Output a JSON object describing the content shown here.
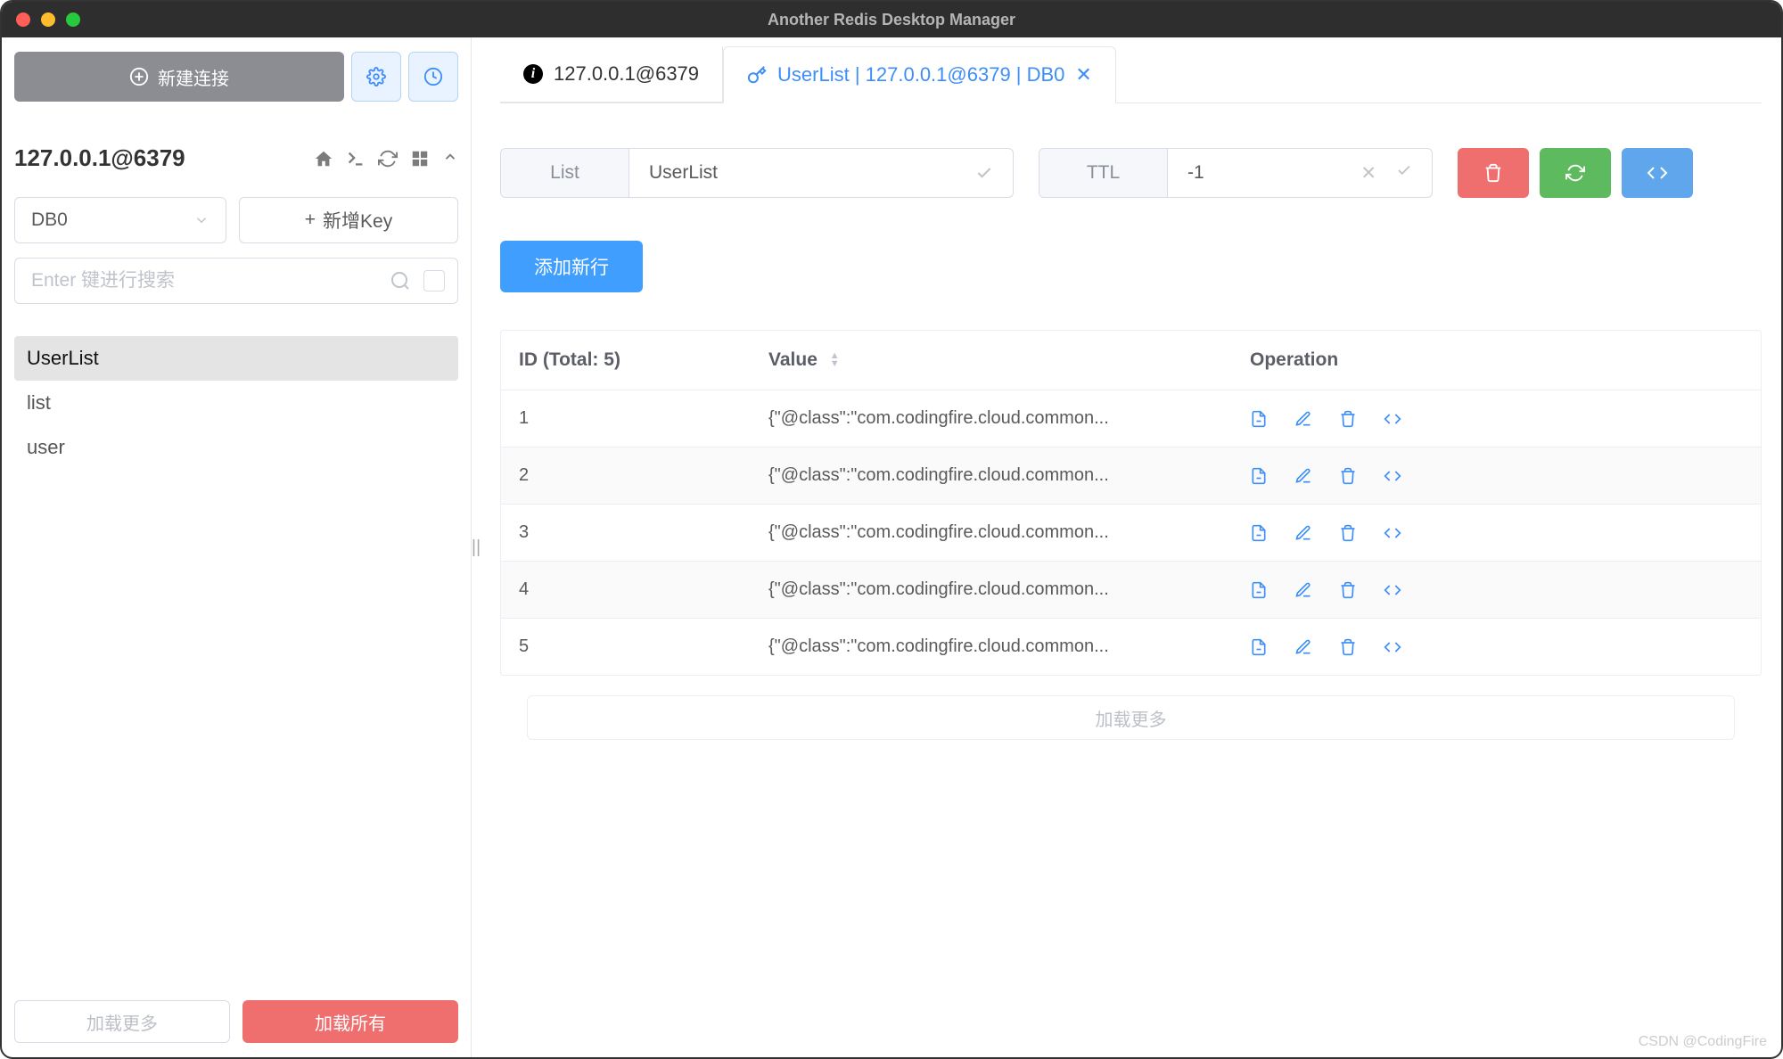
{
  "app": {
    "title": "Another Redis Desktop Manager"
  },
  "sidebar": {
    "newConn": "新建连接",
    "connection": "127.0.0.1@6379",
    "dbSelected": "DB0",
    "newKey": "新增Key",
    "searchPlaceholder": "Enter 键进行搜索",
    "keys": [
      {
        "name": "UserList",
        "active": true
      },
      {
        "name": "list",
        "active": false
      },
      {
        "name": "user",
        "active": false
      }
    ],
    "loadMore": "加载更多",
    "loadAll": "加载所有"
  },
  "tabs": [
    {
      "type": "info",
      "label": "127.0.0.1@6379",
      "active": false
    },
    {
      "type": "key",
      "label": "UserList | 127.0.0.1@6379 | DB0",
      "active": true
    }
  ],
  "toolbar": {
    "keyTypeLabel": "List",
    "keyName": "UserList",
    "ttlLabel": "TTL",
    "ttlValue": "-1"
  },
  "addRow": "添加新行",
  "table": {
    "idHeader": "ID (Total: 5)",
    "valueHeader": "Value",
    "opHeader": "Operation",
    "rows": [
      {
        "id": "1",
        "value": "{\"@class\":\"com.codingfire.cloud.common..."
      },
      {
        "id": "2",
        "value": "{\"@class\":\"com.codingfire.cloud.common..."
      },
      {
        "id": "3",
        "value": "{\"@class\":\"com.codingfire.cloud.common..."
      },
      {
        "id": "4",
        "value": "{\"@class\":\"com.codingfire.cloud.common..."
      },
      {
        "id": "5",
        "value": "{\"@class\":\"com.codingfire.cloud.common..."
      }
    ],
    "loadMore": "加载更多"
  },
  "watermark": "CSDN @CodingFire"
}
